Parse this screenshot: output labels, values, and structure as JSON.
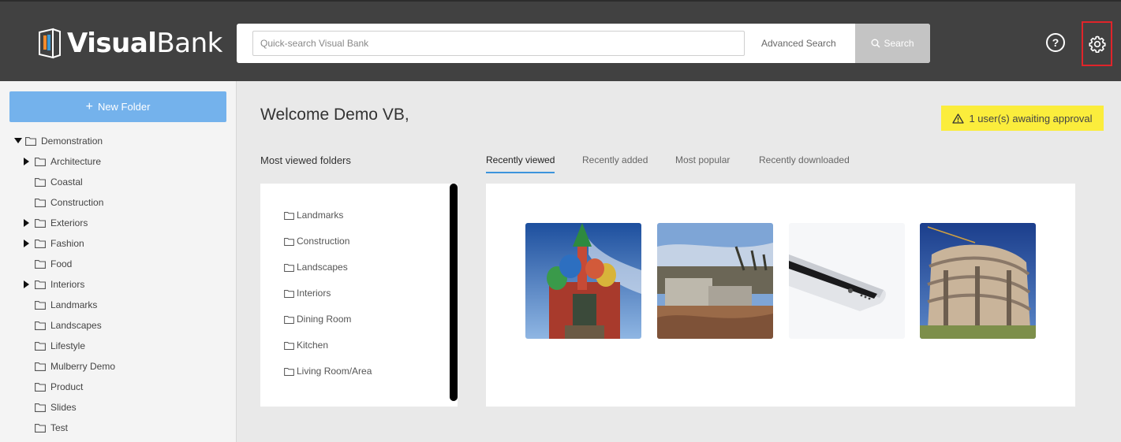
{
  "app": {
    "brand_primary": "Visual",
    "brand_secondary": "Bank",
    "accent": "#74b2ec",
    "header_bg": "#414141"
  },
  "header": {
    "search_placeholder": "Quick-search Visual Bank",
    "advanced_search": "Advanced Search",
    "search_button": "Search",
    "help_icon": "help-icon",
    "settings_icon": "gear-icon"
  },
  "sidebar": {
    "new_folder": "New Folder",
    "root": "Demonstration",
    "items": [
      {
        "label": "Architecture",
        "expandable": true
      },
      {
        "label": "Coastal",
        "expandable": false
      },
      {
        "label": "Construction",
        "expandable": false
      },
      {
        "label": "Exteriors",
        "expandable": true
      },
      {
        "label": "Fashion",
        "expandable": true
      },
      {
        "label": "Food",
        "expandable": false
      },
      {
        "label": "Interiors",
        "expandable": true
      },
      {
        "label": "Landmarks",
        "expandable": false
      },
      {
        "label": "Landscapes",
        "expandable": false
      },
      {
        "label": "Lifestyle",
        "expandable": false
      },
      {
        "label": "Mulberry Demo",
        "expandable": false
      },
      {
        "label": "Product",
        "expandable": false
      },
      {
        "label": "Slides",
        "expandable": false
      },
      {
        "label": "Test",
        "expandable": false
      }
    ]
  },
  "main": {
    "welcome": "Welcome Demo VB,",
    "approval": "1 user(s) awaiting approval",
    "most_viewed_title": "Most viewed folders",
    "most_viewed": [
      "Landmarks",
      "Construction",
      "Landscapes",
      "Interiors",
      "Dining Room",
      "Kitchen",
      "Living Room/Area"
    ],
    "tabs": [
      "Recently viewed",
      "Recently added",
      "Most popular",
      "Recently downloaded"
    ],
    "active_tab": "Recently viewed"
  }
}
